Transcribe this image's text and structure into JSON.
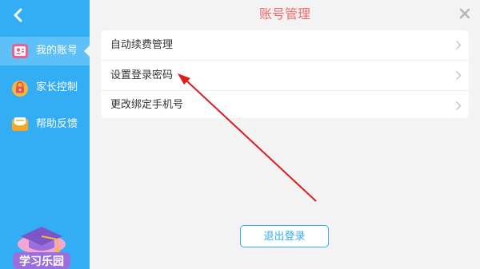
{
  "sidebar": {
    "items": [
      {
        "label": "我的账号",
        "icon": "account-card-icon",
        "active": true
      },
      {
        "label": "家长控制",
        "icon": "lock-icon",
        "active": false
      },
      {
        "label": "帮助反馈",
        "icon": "envelope-icon",
        "active": false
      }
    ],
    "logo_text": "学习乐园"
  },
  "main": {
    "title": "账号管理",
    "menu_rows": [
      {
        "label": "自动续费管理"
      },
      {
        "label": "设置登录密码"
      },
      {
        "label": "更改绑定手机号"
      }
    ],
    "logout_label": "退出登录"
  },
  "colors": {
    "sidebar_bg": "#33aef4",
    "title_red": "#ee6a6a",
    "annotation_arrow": "#dd1c1c"
  }
}
